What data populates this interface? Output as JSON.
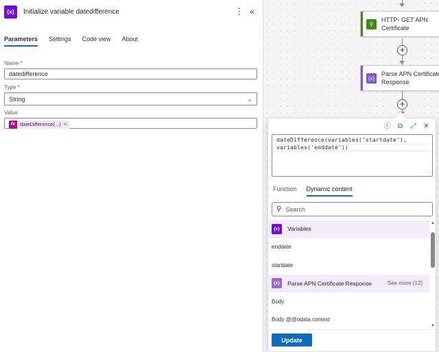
{
  "panel": {
    "icon": "{x}",
    "title": "Initialize variable datedifference",
    "more_icon": "⋮",
    "collapse_icon": "«"
  },
  "tabs": [
    "Parameters",
    "Settings",
    "Code view",
    "About"
  ],
  "active_tab": "Parameters",
  "form": {
    "name_label": "Name *",
    "name_value": "datedifference",
    "type_label": "Type *",
    "type_value": "String",
    "value_label": "Value",
    "value_token": "dateDifference(...)",
    "token_icon": "fx",
    "token_remove": "×"
  },
  "canvas": {
    "actions": [
      {
        "title_line1": "HTTP- GET APN",
        "title_line2": "Certificate",
        "icon": "⚲",
        "color": "#3e8a1a"
      },
      {
        "title_line1": "Parse APN Certificate",
        "title_line2": "Response",
        "icon": "{x}",
        "color": "#7a56d1"
      }
    ],
    "add_icon": "+"
  },
  "popup": {
    "tool_icons": [
      "ⓘ",
      "⧉",
      "⤢",
      "✕"
    ],
    "expression_line1": "dateDifference(variables('startdate'),",
    "expression_line2": "variables('enddate'))",
    "tabs": [
      "Function",
      "Dynamic content"
    ],
    "active_tab": "Dynamic content",
    "search_placeholder": "Search",
    "items": [
      {
        "type": "group",
        "label": "Variables",
        "icon": "{x}"
      },
      {
        "type": "item",
        "label": "enddate"
      },
      {
        "type": "item",
        "label": "startdate"
      },
      {
        "type": "group",
        "label": "Parse APN Certificate Response",
        "icon": "{x}",
        "see_more": "See more (12)"
      },
      {
        "type": "item",
        "label": "Body"
      },
      {
        "type": "item",
        "label": "Body @@odata.context"
      }
    ],
    "update_label": "Update"
  },
  "colors": {
    "accent": "#0f6cbd",
    "variable_purple": "#770bd6",
    "expression_pink": "#ae0c8b"
  }
}
